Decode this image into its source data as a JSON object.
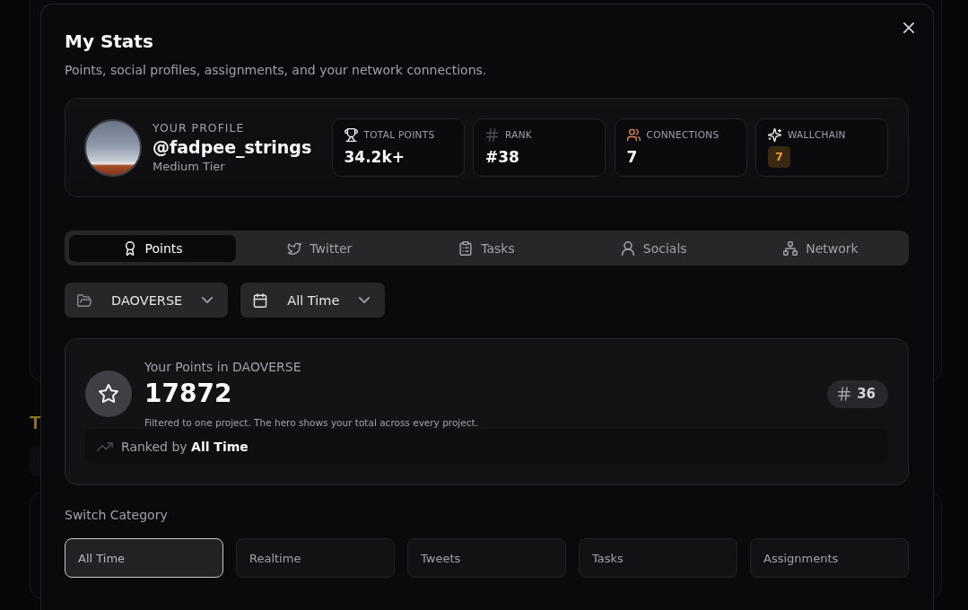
{
  "background": {
    "heading": "T"
  },
  "dialog": {
    "title": "My Stats",
    "subtitle": "Points, social profiles, assignments, and your network connections."
  },
  "profile": {
    "label": "YOUR PROFILE",
    "handle": "@fadpee_strings",
    "tier": "Medium Tier"
  },
  "stats": [
    {
      "kind": "value",
      "label": "TOTAL POINTS",
      "value": "34.2k+"
    },
    {
      "kind": "value",
      "label": "RANK",
      "value": "#38"
    },
    {
      "kind": "value",
      "label": "CONNECTIONS",
      "value": "7"
    },
    {
      "kind": "badge",
      "label": "WALLCHAIN",
      "value": "7"
    }
  ],
  "tabs": [
    {
      "label": "Points",
      "selected": true
    },
    {
      "label": "Twitter",
      "selected": false
    },
    {
      "label": "Tasks",
      "selected": false
    },
    {
      "label": "Socials",
      "selected": false
    },
    {
      "label": "Network",
      "selected": false
    }
  ],
  "filters": [
    {
      "kind": "project",
      "value": "DAOVERSE"
    },
    {
      "kind": "period",
      "value": "All Time"
    }
  ],
  "points_card": {
    "title": "Your Points in DAOVERSE",
    "value": "17872",
    "note": "Filtered to one project. The hero shows your total across every project.",
    "rank": "36",
    "ranked_by": "Ranked by **All Time**"
  },
  "categories": {
    "label": "Switch Category",
    "options": [
      {
        "label": "All Time",
        "selected": true
      },
      {
        "label": "Realtime",
        "selected": false
      },
      {
        "label": "Tweets",
        "selected": false
      },
      {
        "label": "Tasks",
        "selected": false
      },
      {
        "label": "Assignments",
        "selected": false
      }
    ]
  }
}
